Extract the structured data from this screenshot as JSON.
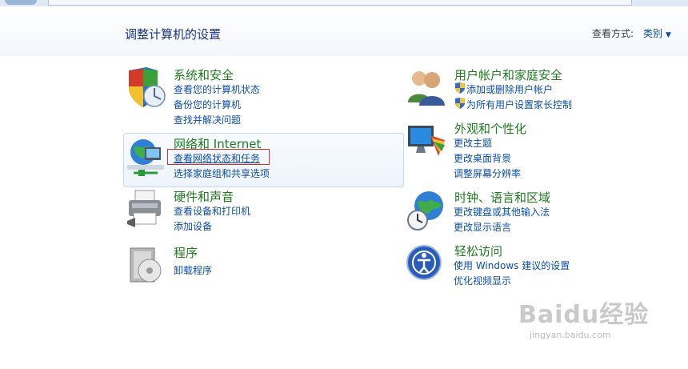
{
  "header": {
    "title": "调整计算机的设置",
    "view_by_label": "查看方式:",
    "view_by_value": "类别"
  },
  "categories": {
    "security": {
      "title": "系统和安全",
      "links": [
        "查看您的计算机状态",
        "备份您的计算机",
        "查找并解决问题"
      ]
    },
    "network": {
      "title": "网络和 Internet",
      "links": [
        "查看网络状态和任务",
        "选择家庭组和共享选项"
      ]
    },
    "hardware": {
      "title": "硬件和声音",
      "links": [
        "查看设备和打印机",
        "添加设备"
      ]
    },
    "programs": {
      "title": "程序",
      "links": [
        "卸载程序"
      ]
    },
    "users": {
      "title": "用户帐户和家庭安全",
      "links": [
        "添加或删除用户帐户",
        "为所有用户设置家长控制"
      ]
    },
    "appearance": {
      "title": "外观和个性化",
      "links": [
        "更改主题",
        "更改桌面背景",
        "调整屏幕分辨率"
      ]
    },
    "clock": {
      "title": "时钟、语言和区域",
      "links": [
        "更改键盘或其他输入法",
        "更改显示语言"
      ]
    },
    "access": {
      "title": "轻松访问",
      "links": [
        "使用 Windows 建议的设置",
        "优化视频显示"
      ]
    }
  },
  "watermark": {
    "brand": "Baidu经验",
    "url": "jingyan.baidu.com"
  },
  "colors": {
    "heading": "#1e7d1e",
    "link": "#0d4ea6",
    "title": "#1e3287",
    "highlight_border": "#d9302c"
  }
}
